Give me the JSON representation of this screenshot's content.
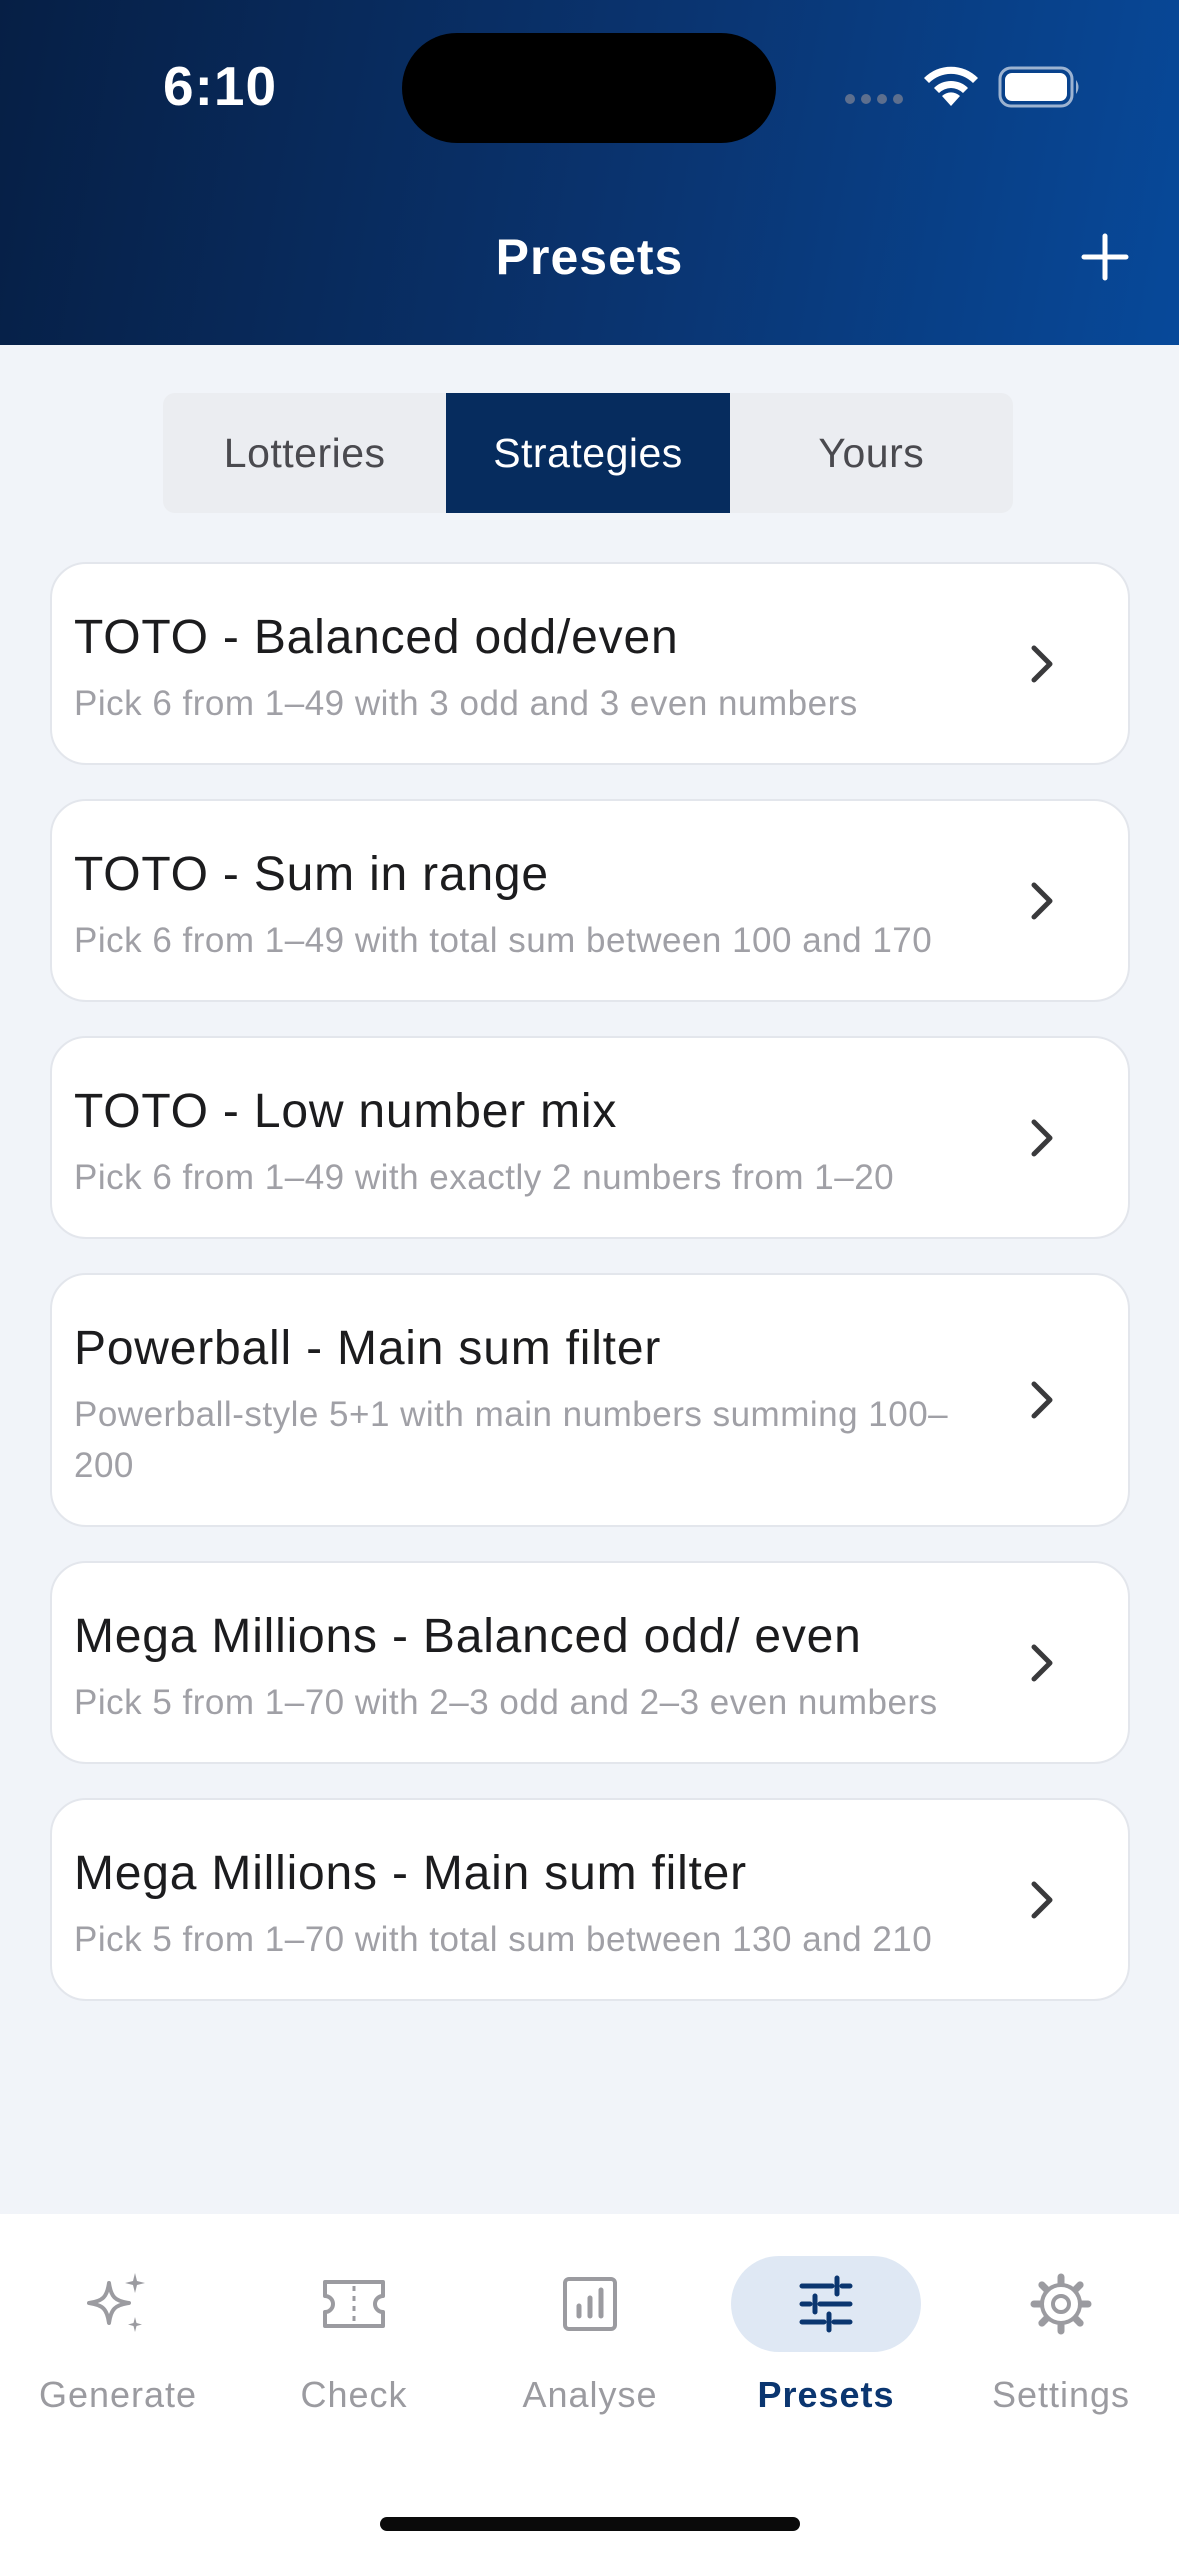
{
  "status": {
    "time": "6:10"
  },
  "header": {
    "title": "Presets"
  },
  "tabs": [
    {
      "label": "Lotteries"
    },
    {
      "label": "Strategies"
    },
    {
      "label": "Yours"
    }
  ],
  "active_tab": "Strategies",
  "presets": [
    {
      "title": "TOTO - Balanced odd/even",
      "description": "Pick 6 from 1–49 with 3 odd and 3 even numbers"
    },
    {
      "title": "TOTO - Sum in range",
      "description": "Pick 6 from 1–49 with total sum between 100 and 170"
    },
    {
      "title": "TOTO - Low number mix",
      "description": "Pick 6 from 1–49 with exactly 2 numbers from 1–20"
    },
    {
      "title": "Powerball - Main sum filter",
      "description": "Powerball-style 5+1 with main numbers summing 100–200"
    },
    {
      "title": "Mega Millions - Balanced odd/ even",
      "description": "Pick 5 from 1–70 with 2–3 odd and 2–3 even numbers"
    },
    {
      "title": "Mega Millions - Main sum filter",
      "description": "Pick 5 from 1–70 with total sum between 130 and 210"
    }
  ],
  "nav": [
    {
      "label": "Generate",
      "icon": "sparkles-icon"
    },
    {
      "label": "Check",
      "icon": "ticket-icon"
    },
    {
      "label": "Analyse",
      "icon": "chart-icon"
    },
    {
      "label": "Presets",
      "icon": "sliders-icon"
    },
    {
      "label": "Settings",
      "icon": "gear-icon"
    }
  ],
  "active_nav": "Presets",
  "colors": {
    "accent": "#062c5e",
    "header_start": "#061f45",
    "header_end": "#07499a",
    "background": "#f1f4f9"
  }
}
